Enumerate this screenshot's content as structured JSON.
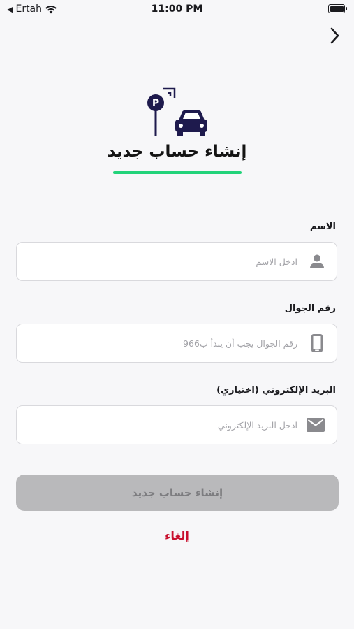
{
  "status_bar": {
    "carrier": "Ertah",
    "time": "11:00 PM"
  },
  "nav": {
    "back_icon": "chevron-right-icon"
  },
  "header": {
    "logo_icon": "parking-car-icon",
    "title": "إنشاء حساب جديد",
    "accent_color": "#22d37a"
  },
  "form": {
    "name": {
      "label": "الاسم",
      "placeholder": "ادخل الاسم",
      "value": "",
      "icon": "person-icon"
    },
    "phone": {
      "label": "رقم الجوال",
      "placeholder": "رقم الجوال يجب أن يبدأ ب966",
      "value": "",
      "icon": "mobile-phone-icon"
    },
    "email": {
      "label": "البريد الإلكتروني  (اختياري)",
      "placeholder": "ادخل البريد الإلكتروني",
      "value": "",
      "icon": "envelope-icon"
    }
  },
  "actions": {
    "submit_label": "إنشاء حساب جديد",
    "cancel_label": "إلغاء",
    "cancel_color": "#c8102e"
  }
}
